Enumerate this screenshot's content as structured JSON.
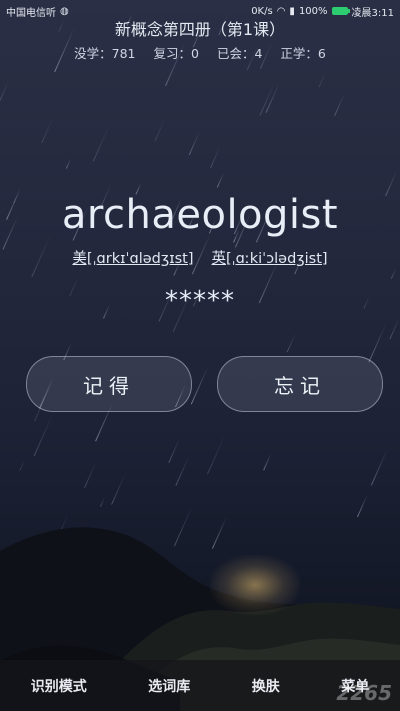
{
  "status_bar": {
    "carrier": "中国电信听",
    "speed": "0K/s",
    "battery": "100%",
    "time": "凌晨3:11"
  },
  "header": {
    "title": "新概念第四册（第1课）",
    "stats": [
      {
        "label": "没学：781"
      },
      {
        "label": "复习：0"
      },
      {
        "label": "已会：4"
      },
      {
        "label": "正学：6"
      }
    ]
  },
  "card": {
    "word": "archaeologist",
    "phonetic_us": "美[ˌɑrkɪˈɑlədʒɪst]",
    "phonetic_uk": "英[ˌɑːkiˈɔlədʒist]",
    "masked": "*****"
  },
  "actions": {
    "remember": "记得",
    "forget": "忘记"
  },
  "bottom_nav": {
    "items": [
      "识别模式",
      "选词库",
      "换肤",
      "菜单"
    ]
  },
  "watermark": "2265",
  "colors": {
    "battery": "#2ecc71",
    "nav_bg": "#14161a"
  }
}
